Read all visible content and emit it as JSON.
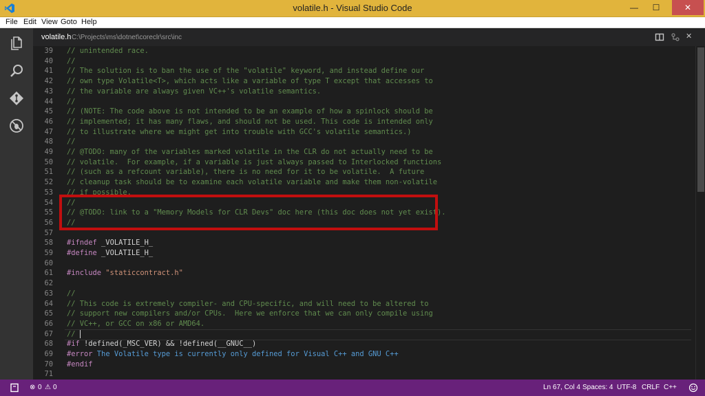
{
  "window": {
    "title": "volatile.h - Visual Studio Code",
    "minimize": "—",
    "maximize": "☐",
    "close": "✕"
  },
  "menu": [
    "File",
    "Edit",
    "View",
    "Goto",
    "Help"
  ],
  "activity_bar": [
    "explorer-icon",
    "search-icon",
    "git-icon",
    "debug-icon"
  ],
  "editor_header": {
    "file_name": "volatile.h",
    "file_path": "C:\\Projects\\ms\\dotnet\\coreclr\\src\\inc",
    "icons": [
      "split-editor-icon",
      "open-changes-icon",
      "close-icon"
    ],
    "close_glyph": "✕"
  },
  "code_lines": [
    {
      "n": "39",
      "text": "// unintended race.",
      "type": "cm"
    },
    {
      "n": "40",
      "text": "//",
      "type": "cm"
    },
    {
      "n": "41",
      "text": "// The solution is to ban the use of the \"volatile\" keyword, and instead define our",
      "type": "cm"
    },
    {
      "n": "42",
      "text": "// own type Volatile<T>, which acts like a variable of type T except that accesses to",
      "type": "cm"
    },
    {
      "n": "43",
      "text": "// the variable are always given VC++'s volatile semantics.",
      "type": "cm"
    },
    {
      "n": "44",
      "text": "//",
      "type": "cm"
    },
    {
      "n": "45",
      "text": "// (NOTE: The code above is not intended to be an example of how a spinlock should be",
      "type": "cm"
    },
    {
      "n": "46",
      "text": "// implemented; it has many flaws, and should not be used. This code is intended only",
      "type": "cm"
    },
    {
      "n": "47",
      "text": "// to illustrate where we might get into trouble with GCC's volatile semantics.)",
      "type": "cm"
    },
    {
      "n": "48",
      "text": "//",
      "type": "cm"
    },
    {
      "n": "49",
      "text": "// @TODO: many of the variables marked volatile in the CLR do not actually need to be",
      "type": "cm"
    },
    {
      "n": "50",
      "text": "// volatile.  For example, if a variable is just always passed to Interlocked functions",
      "type": "cm"
    },
    {
      "n": "51",
      "text": "// (such as a refcount variable), there is no need for it to be volatile.  A future",
      "type": "cm"
    },
    {
      "n": "52",
      "text": "// cleanup task should be to examine each volatile variable and make them non-volatile",
      "type": "cm"
    },
    {
      "n": "53",
      "text": "// if possible.",
      "type": "cm"
    },
    {
      "n": "54",
      "text": "//",
      "type": "cm"
    },
    {
      "n": "55",
      "text": "// @TODO: link to a \"Memory Models for CLR Devs\" doc here (this doc does not yet exist).",
      "type": "cm"
    },
    {
      "n": "56",
      "text": "//",
      "type": "cm"
    },
    {
      "n": "57",
      "text": "",
      "type": "pl"
    },
    {
      "n": "58",
      "text": "#ifndef _VOLATILE_H_",
      "type": "pp",
      "kw": "#ifndef",
      "rest": " _VOLATILE_H_"
    },
    {
      "n": "59",
      "text": "#define _VOLATILE_H_",
      "type": "pp",
      "kw": "#define",
      "rest": " _VOLATILE_H_"
    },
    {
      "n": "60",
      "text": "",
      "type": "pl"
    },
    {
      "n": "61",
      "text": "#include \"staticcontract.h\"",
      "type": "inc",
      "kw": "#include",
      "rest": " \"staticcontract.h\""
    },
    {
      "n": "62",
      "text": "",
      "type": "pl"
    },
    {
      "n": "63",
      "text": "//",
      "type": "cm"
    },
    {
      "n": "64",
      "text": "// This code is extremely compiler- and CPU-specific, and will need to be altered to",
      "type": "cm"
    },
    {
      "n": "65",
      "text": "// support new compilers and/or CPUs.  Here we enforce that we can only compile using",
      "type": "cm"
    },
    {
      "n": "66",
      "text": "// VC++, or GCC on x86 or AMD64.",
      "type": "cm"
    },
    {
      "n": "67",
      "text": "// ",
      "type": "cm",
      "cursor": true
    },
    {
      "n": "68",
      "text": "#if !defined(_MSC_VER) && !defined(__GNUC__)",
      "type": "pp",
      "kw": "#if",
      "rest": " !defined(_MSC_VER) && !defined(__GNUC__)"
    },
    {
      "n": "69",
      "text": "#error The Volatile type is currently only defined for Visual C++ and GNU C++",
      "type": "pp",
      "kw": "#error",
      "rest": " The Volatile type is currently only defined for Visual C++ and GNU C++"
    },
    {
      "n": "70",
      "text": "#endif",
      "type": "pp",
      "kw": "#endif",
      "rest": ""
    },
    {
      "n": "71",
      "text": "",
      "type": "pl"
    }
  ],
  "status_bar": {
    "errors": "0",
    "warnings": "0",
    "position": "Ln 67, Col 4",
    "indent": "Spaces: 4",
    "encoding": "UTF-8",
    "eol": "CRLF",
    "language": "C++",
    "feedback_icon": "smiley-icon",
    "color": "#68217a"
  }
}
